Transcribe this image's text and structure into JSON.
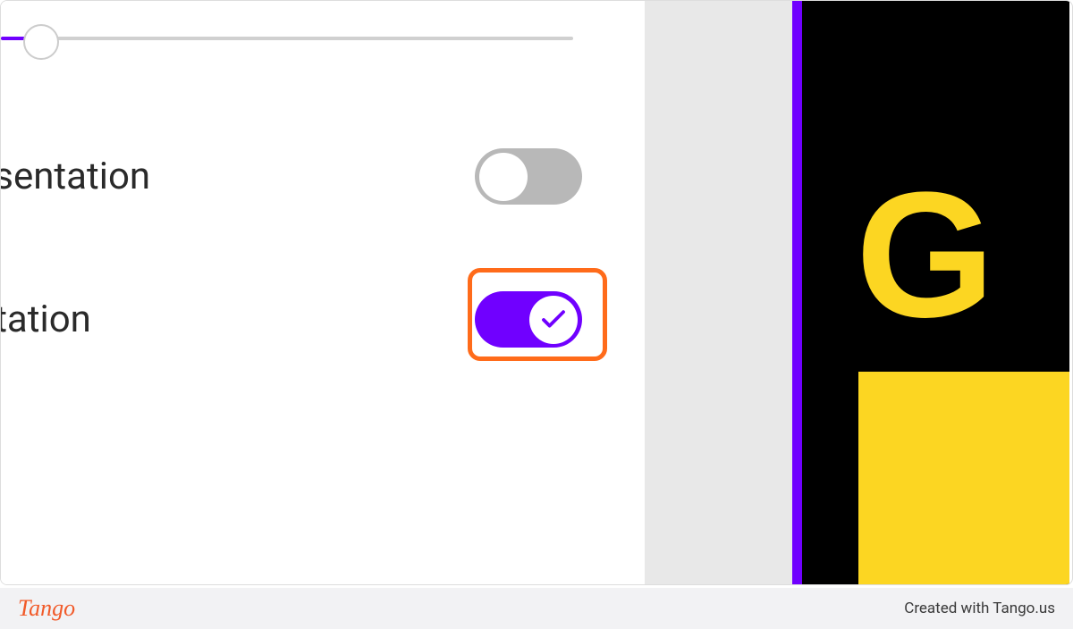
{
  "settings": {
    "slider": {
      "value": 5,
      "min": 0,
      "max": 100
    },
    "options": [
      {
        "label": "esentation",
        "enabled": false
      },
      {
        "label": "ntation",
        "enabled": true,
        "highlighted": true
      }
    ]
  },
  "preview": {
    "text_fragment": "G",
    "colors": {
      "background": "#000000",
      "accent": "#7000ff",
      "text": "#fcd622"
    }
  },
  "footer": {
    "logo": "Tango",
    "attribution": "Created with Tango.us"
  }
}
